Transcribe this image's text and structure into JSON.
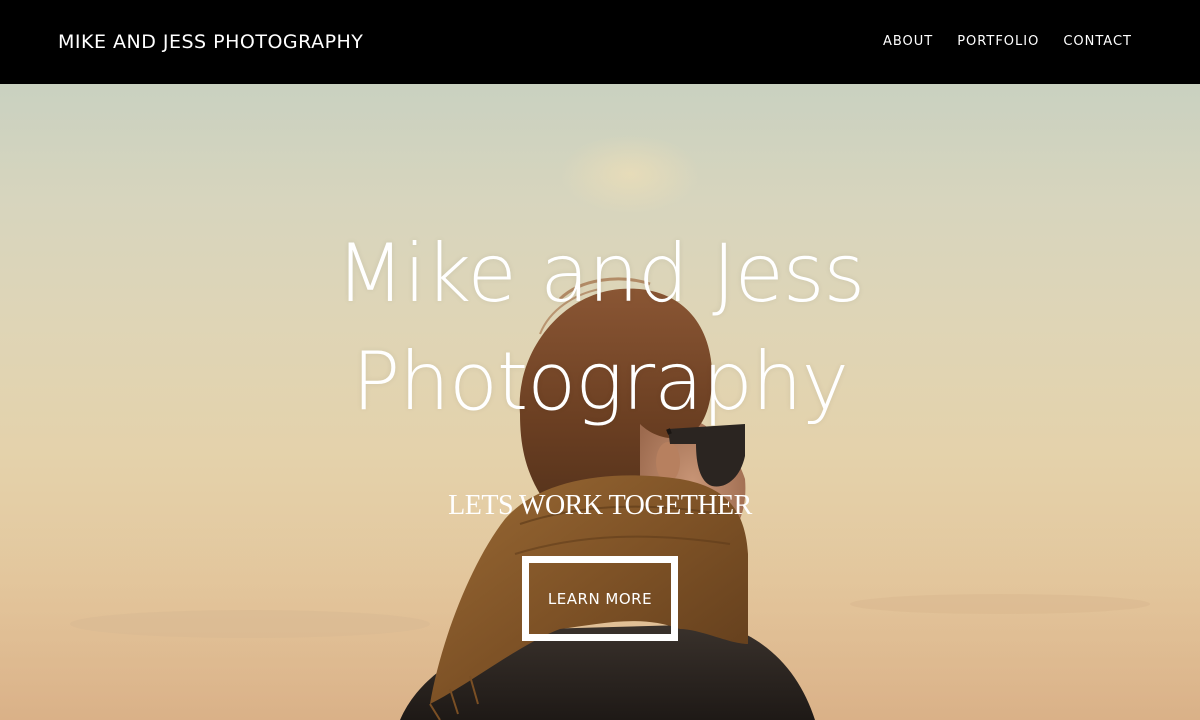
{
  "header": {
    "brand": "MIKE AND JESS PHOTOGRAPHY",
    "nav": [
      {
        "label": "ABOUT"
      },
      {
        "label": "PORTFOLIO"
      },
      {
        "label": "CONTACT"
      }
    ]
  },
  "hero": {
    "title_line1": "Mike and Jess",
    "title_line2": "Photography",
    "subtitle": "LETS WORK TOGETHER",
    "cta_label": "LEARN MORE",
    "background_image": "person-with-scarf-and-sunglasses-at-sunset"
  },
  "colors": {
    "header_bg": "#000000",
    "text": "#ffffff",
    "sky_top": "#c9d1c0",
    "sky_bottom": "#dcb88e",
    "scarf": "#8a5a2b",
    "hair": "#6b4326"
  }
}
